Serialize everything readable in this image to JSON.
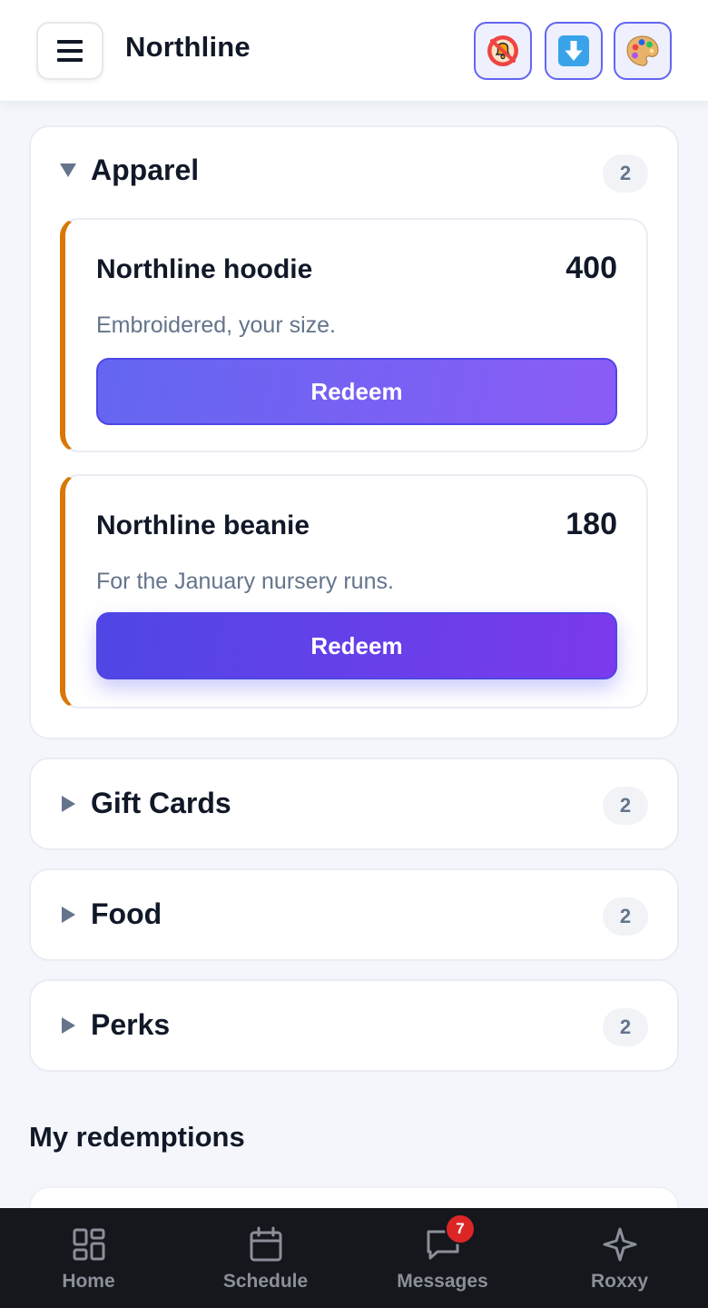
{
  "header": {
    "title": "Northline",
    "icons": [
      "mute-notifications-icon",
      "download-icon",
      "palette-icon"
    ]
  },
  "categories": [
    {
      "name": "Apparel",
      "count": "2",
      "expanded": true,
      "rewards": [
        {
          "name": "Northline hoodie",
          "points": "400",
          "description": "Embroidered, your size.",
          "button": "Redeem"
        },
        {
          "name": "Northline beanie",
          "points": "180",
          "description": "For the January nursery runs.",
          "button": "Redeem"
        }
      ]
    },
    {
      "name": "Gift Cards",
      "count": "2",
      "expanded": false
    },
    {
      "name": "Food",
      "count": "2",
      "expanded": false
    },
    {
      "name": "Perks",
      "count": "2",
      "expanded": false
    }
  ],
  "redemptions": {
    "title": "My redemptions"
  },
  "nav": {
    "items": [
      {
        "label": "Home",
        "icon": "grid-icon"
      },
      {
        "label": "Schedule",
        "icon": "calendar-icon"
      },
      {
        "label": "Messages",
        "icon": "chat-icon",
        "badge": "7"
      },
      {
        "label": "Roxxy",
        "icon": "sparkle-icon"
      }
    ]
  },
  "colors": {
    "accent": "#6366f1",
    "accent_secondary": "#8b5cf6",
    "reward_stripe": "#d97706",
    "nav_background": "#15171c",
    "badge": "#dc2626"
  }
}
